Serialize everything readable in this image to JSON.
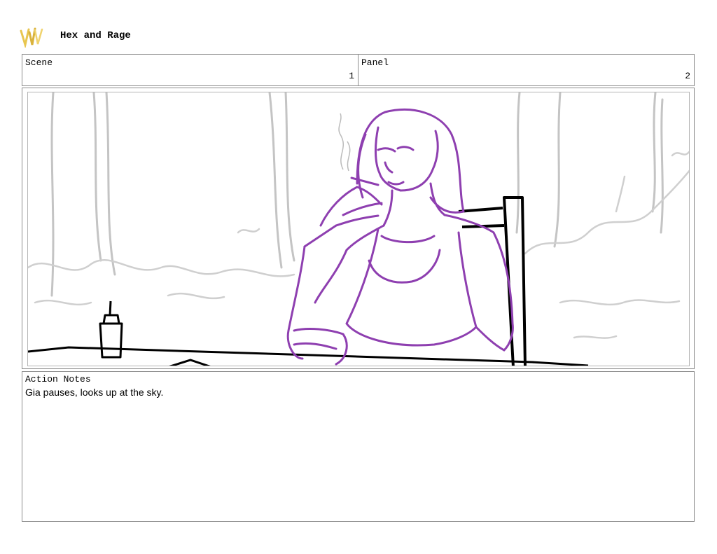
{
  "header": {
    "logo_icon": "brush-signature-logo",
    "logo_color": "#e8c650",
    "title": "Hex and Rage"
  },
  "scene": {
    "label": "Scene",
    "value": "1"
  },
  "panel": {
    "label": "Panel",
    "value": "2"
  },
  "artwork": {
    "icon": "storyboard-sketch-illustration",
    "character_line_color": "#8e3fb0",
    "background_line_color": "#bdbdbd"
  },
  "action_notes": {
    "label": "Action Notes",
    "text": "Gia pauses, looks up at the sky."
  }
}
